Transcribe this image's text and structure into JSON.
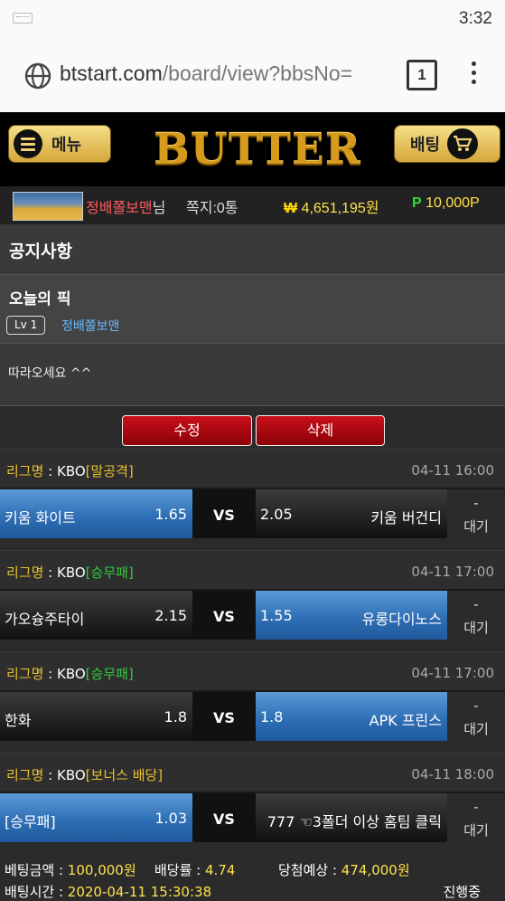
{
  "statusbar": {
    "time": "3:32"
  },
  "browser": {
    "url_main": "btstart.com",
    "url_path": "/board/view?bbsNo=",
    "tab_count": "1"
  },
  "header": {
    "menu_label": "메뉴",
    "logo_text": "BUTTER",
    "bet_label": "배팅"
  },
  "user": {
    "name": "정배쫄보맨",
    "suffix": "님",
    "messages": "쪽지:0통",
    "money_symbol": "₩",
    "money": "4,651,195원",
    "points_symbol": "P",
    "points": "10,000P"
  },
  "board": {
    "title": "공지사항"
  },
  "post": {
    "title": "오늘의 픽",
    "level": "Lv 1",
    "author": "정배쫄보맨",
    "body": "따라오세요 ^^"
  },
  "actions": {
    "edit": "수정",
    "delete": "삭제"
  },
  "games": [
    {
      "league_label": "리그명",
      "league": " : KBO",
      "type": "[말공격]",
      "type_color": "yellow",
      "time": "04-11 16:00",
      "home": "키움 화이트",
      "home_odds": "1.65",
      "vs": "VS",
      "away_odds": "2.05",
      "away": "키움 버건디",
      "selected": "home",
      "dash": "-",
      "status": "대기"
    },
    {
      "league_label": "리그명",
      "league": " : KBO",
      "type": "[승무패]",
      "type_color": "green",
      "time": "04-11 17:00",
      "home": "가오슝주타이",
      "home_odds": "2.15",
      "vs": "VS",
      "away_odds": "1.55",
      "away": "유롱다이노스",
      "selected": "away",
      "dash": "-",
      "status": "대기"
    },
    {
      "league_label": "리그명",
      "league": " : KBO",
      "type": "[승무패]",
      "type_color": "green",
      "time": "04-11 17:00",
      "home": "한화",
      "home_odds": "1.8",
      "vs": "VS",
      "away_odds": "1.8",
      "away": "APK 프린스",
      "selected": "away",
      "dash": "-",
      "status": "대기"
    },
    {
      "league_label": "리그명",
      "league": " : KBO",
      "type": "[보너스 배당]",
      "type_color": "yellow",
      "time": "04-11 18:00",
      "home": "[승무패]",
      "home_odds": "1.03",
      "vs": "VS",
      "away_odds": "",
      "away": "777 ☜3폴더 이상 홈팀 클릭",
      "selected": "home",
      "dash": "-",
      "status": "대기"
    }
  ],
  "summary": {
    "bet_amount_label": "베팅금액 : ",
    "bet_amount": "100,000원",
    "rate_label": "배당률 : ",
    "rate": "4.74",
    "expected_label": "당첨예상 : ",
    "expected": "474,000원",
    "bet_time_label": "배팅시간 : ",
    "bet_time": "2020-04-11 15:30:38",
    "state": "진행중"
  }
}
